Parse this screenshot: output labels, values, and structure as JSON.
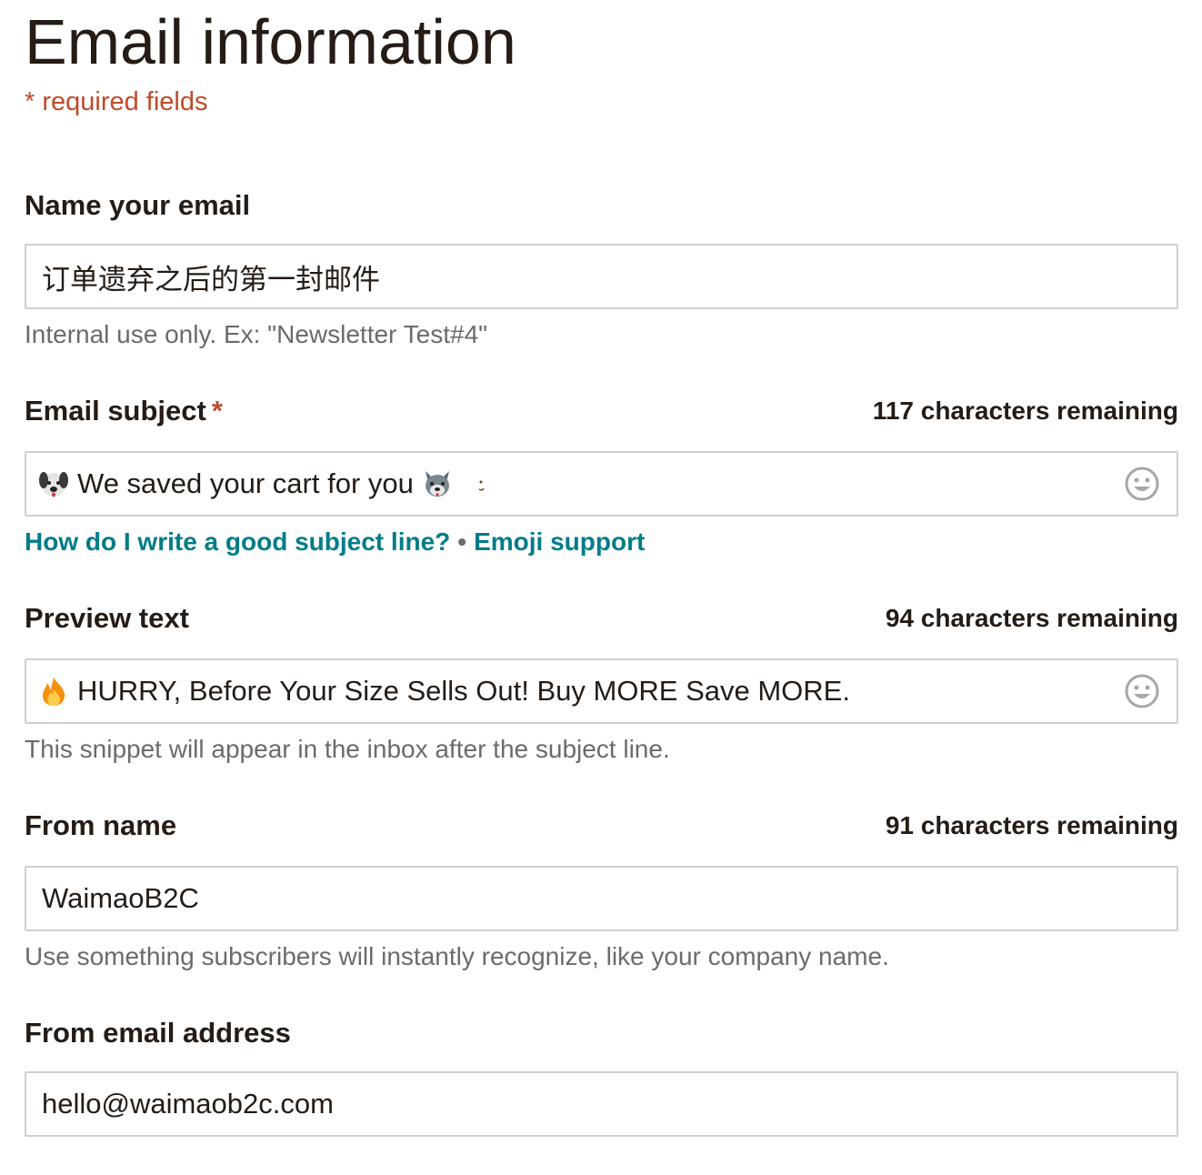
{
  "header": {
    "title": "Email information",
    "required_note": "* required fields"
  },
  "fields": {
    "name": {
      "label": "Name your email",
      "value": "订单遗弃之后的第一封邮件",
      "helper": "Internal use only. Ex: \"Newsletter Test#4\""
    },
    "subject": {
      "label": "Email subject",
      "required_mark": "*",
      "counter": "117 characters remaining",
      "value": "We saved your cart for you",
      "leading_emoji": "dog-face-icon",
      "trailing_emojis": [
        "wolf-face-icon",
        "crescent-moon-icon"
      ],
      "emoji_button_icon": "smiley-icon",
      "link_help": "How do I write a good subject line?",
      "link_separator": "•",
      "link_emoji": "Emoji support"
    },
    "preview": {
      "label": "Preview text",
      "counter": "94 characters remaining",
      "value": "HURRY, Before Your Size Sells Out! Buy MORE Save MORE.",
      "leading_emoji": "fire-icon",
      "emoji_button_icon": "smiley-icon",
      "helper": "This snippet will appear in the inbox after the subject line."
    },
    "from_name": {
      "label": "From name",
      "counter": "91 characters remaining",
      "value": "WaimaoB2C",
      "helper": "Use something subscribers will instantly recognize, like your company name."
    },
    "from_email": {
      "label": "From email address",
      "value": "hello@waimaob2c.com"
    }
  },
  "colors": {
    "text": "#241c15",
    "muted": "#6b6b6b",
    "required": "#c04a2a",
    "link": "#007c89",
    "border": "#cfcfcf"
  }
}
